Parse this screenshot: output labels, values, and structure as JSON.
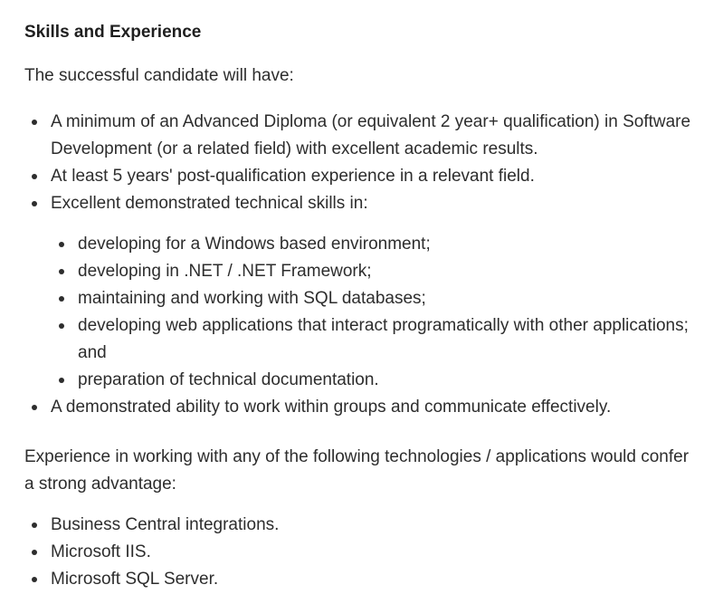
{
  "section": {
    "heading": "Skills and Experience",
    "intro": "The successful candidate will have:",
    "requirements": [
      "A minimum of an Advanced Diploma (or equivalent 2 year+ qualification) in Software Development (or a related field) with excellent academic results.",
      "At least 5 years' post-qualification experience in a relevant field.",
      "Excellent demonstrated technical skills in:"
    ],
    "technical_skills": [
      "developing for a Windows based environment;",
      "developing in .NET / .NET Framework;",
      "maintaining and working with SQL databases;",
      "developing web applications that interact programatically with other applications; and",
      "preparation of technical documentation."
    ],
    "final_requirement": "A demonstrated ability to work within groups and communicate effectively.",
    "advantage_intro": "Experience in working with any of the following technologies / applications would confer a strong advantage:",
    "advantages": [
      "Business Central integrations.",
      "Microsoft IIS.",
      "Microsoft SQL Server."
    ]
  }
}
